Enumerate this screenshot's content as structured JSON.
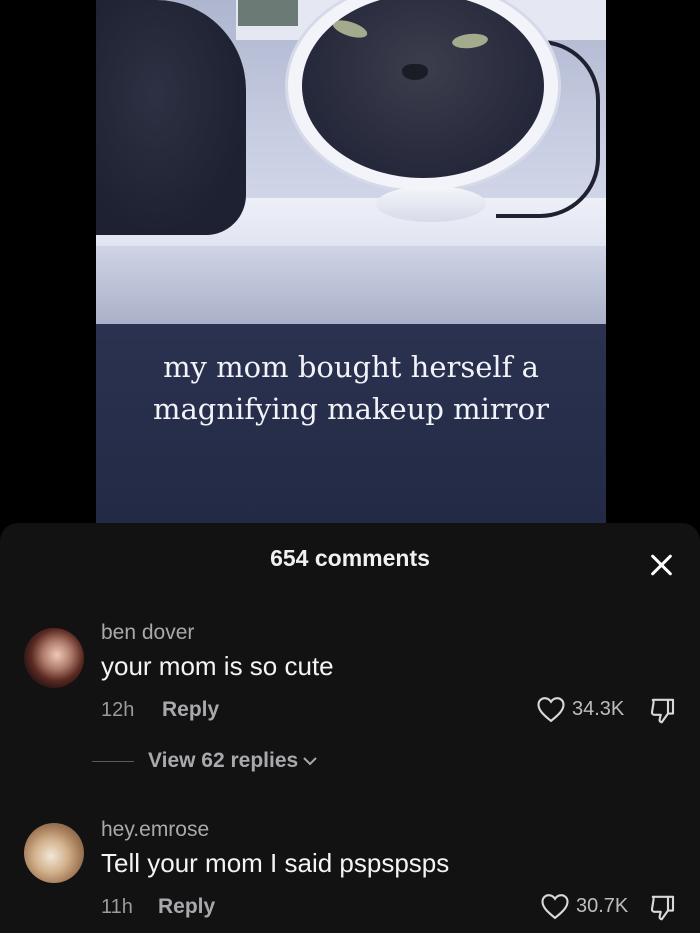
{
  "video": {
    "caption_line1": "my mom bought herself a",
    "caption_line2": "magnifying makeup mirror"
  },
  "comments_panel": {
    "count_label": "654 comments",
    "close_icon": "close-icon",
    "view_replies_label": "View 62 replies",
    "comments": [
      {
        "username": "ben dover",
        "text": "your mom is so cute",
        "time": "12h",
        "reply_label": "Reply",
        "likes": "34.3K"
      },
      {
        "username": "hey.emrose",
        "text": "Tell your mom I said pspspsps",
        "time": "11h",
        "reply_label": "Reply",
        "likes": "30.7K"
      }
    ]
  },
  "colors": {
    "sheet_bg": "#121212",
    "text_primary": "#f4f4f4",
    "text_secondary": "#a9a9ad"
  }
}
